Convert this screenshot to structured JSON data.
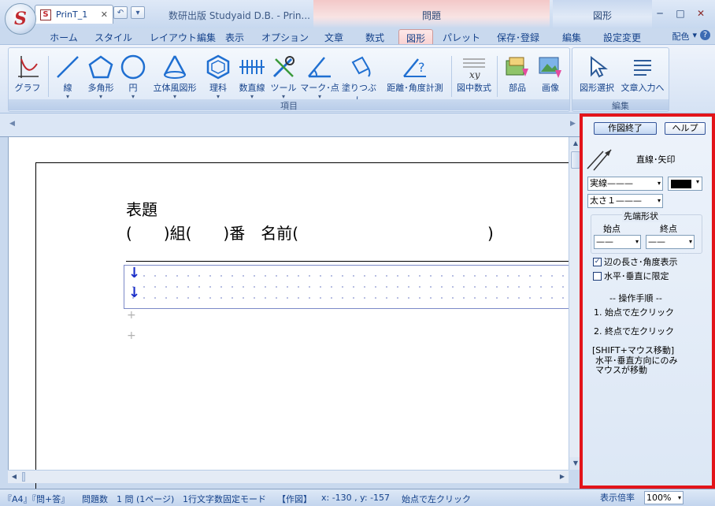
{
  "window": {
    "app_logo": "S",
    "title": "数研出版 Studyaid D.B. - Prin...",
    "context_tab_mondai": "問題",
    "context_tab_zukei": "図形",
    "minimize": "─",
    "maximize": "□",
    "close": "✕"
  },
  "tabs": [
    "ホーム",
    "スタイル",
    "レイアウト編集",
    "表示",
    "オプション",
    "文章",
    "数式",
    "図形",
    "パレット",
    "保存･登録",
    "編集",
    "設定変更"
  ],
  "tab_active": "図形",
  "right_tab": {
    "label": "配色",
    "arrow": "▾",
    "help": "?"
  },
  "ribbon": {
    "group_items_label": "項目",
    "group_edit_label": "編集",
    "buttons": {
      "graph": "グラフ",
      "line": "線",
      "polygon": "多角形",
      "circle": "円",
      "solid": "立体風図形",
      "science": "理科",
      "number_line": "数直線",
      "tool": "ツール",
      "mark": "マーク･点",
      "fill": "塗りつぶし",
      "measure": "距離･角度計測",
      "fig_formula": "図中数式",
      "parts": "部品",
      "image": "画像",
      "select": "図形選択",
      "text_input": "文章入力へ"
    },
    "dropdown_arrow": "▾"
  },
  "document": {
    "tab_label": "PrinT_1",
    "tab_icon_letter": "S",
    "tab_close": "✕",
    "heading": "表題",
    "class_line": "(　　)組(　　)番　名前(　　　　　　　　　　　　)",
    "down_arrow": "↓",
    "plus": "+"
  },
  "panel": {
    "finish_button": "作図終了",
    "help_button": "ヘルプ",
    "mode_title": "直線･矢印",
    "line_style": "実線———",
    "line_width": "太さ１———",
    "tip_shape_label": "先端形状",
    "start_label": "始点",
    "end_label": "終点",
    "start_value": "——",
    "end_value": "——",
    "check_length": "辺の長さ･角度表示",
    "check_hv": "水平･垂直に限定",
    "check_length_checked": true,
    "check_hv_checked": false,
    "procedure_title": "-- 操作手順 --",
    "step1": "1. 始点で左クリック",
    "step2": "2. 終点で左クリック",
    "shift_note": "[SHIFT+マウス移動]",
    "shift_desc1": "水平･垂直方向にのみ",
    "shift_desc2": "マウスが移動",
    "color": "#000000",
    "dd": "▾"
  },
  "statusbar": {
    "paper": "『A4』『問+答』",
    "count": "問題数　1 問 (1ページ)",
    "mode": "1行文字数固定モード",
    "figure": "【作図】",
    "coords": "x: -130 , y: -157",
    "hint": "始点で左クリック",
    "zoom_label": "表示倍率",
    "zoom_value": "100%",
    "dd": "▾"
  },
  "colors": {
    "accent_red": "#e3141a",
    "ribbon_blue": "#15428b",
    "arrow_blue": "#1b2fc9"
  }
}
